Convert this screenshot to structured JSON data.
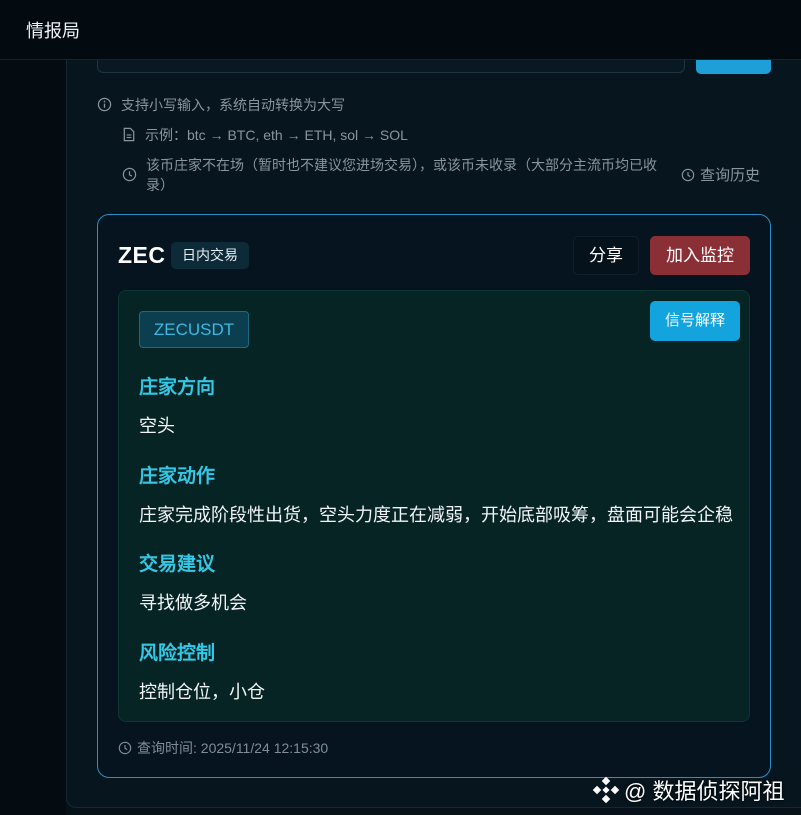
{
  "header": {
    "title": "情报局"
  },
  "hints": {
    "uppercase_note": "支持小写输入，系统自动转换为大写",
    "example": "示例：btc → BTC, eth → ETH, sol → SOL",
    "status_note": "该币庄家不在场（暂时也不建议您进场交易），或该币未收录（大部分主流币均已收录）",
    "history_link": "查询历史"
  },
  "card": {
    "symbol": "ZEC",
    "tag": "日内交易",
    "share_label": "分享",
    "monitor_label": "加入监控",
    "signal_label": "信号解释",
    "pair": "ZECUSDT",
    "sections": [
      {
        "title": "庄家方向",
        "body": "空头"
      },
      {
        "title": "庄家动作",
        "body": "庄家完成阶段性出货，空头力度正在减弱，开始底部吸筹，盘面可能会企稳"
      },
      {
        "title": "交易建议",
        "body": "寻找做多机会"
      },
      {
        "title": "风险控制",
        "body": "控制仓位，小仓"
      }
    ],
    "query_time": "查询时间: 2025/11/24 12:15:30"
  },
  "watermark": {
    "text": "@ 数据侦探阿祖"
  },
  "colors": {
    "accent": "#13a3dd",
    "danger": "#8a2f36",
    "section_title": "#34c8e6",
    "card_border": "#2a8fc6"
  },
  "icons": {
    "uppercase_note": "info-circle-icon",
    "example": "document-icon",
    "status_note": "clock-icon",
    "history_link": "clock-icon",
    "query_time": "clock-icon",
    "watermark": "diamond-logo-icon"
  }
}
